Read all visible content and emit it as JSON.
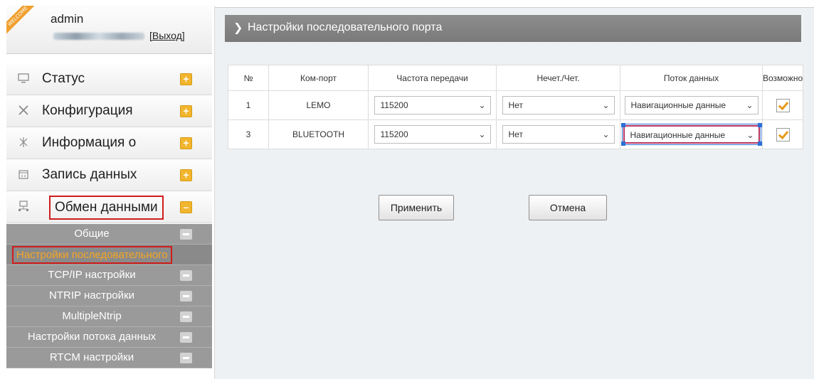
{
  "user": {
    "username": "admin",
    "logout_label": "[Выход]",
    "ribbon_text": "WELCOME"
  },
  "menu": [
    {
      "label": "Статус",
      "icon": "monitor-icon"
    },
    {
      "label": "Конфигурация",
      "icon": "tools-icon"
    },
    {
      "label": "Информация о",
      "icon": "satellite-icon"
    },
    {
      "label": "Запись данных",
      "icon": "calendar-icon"
    },
    {
      "label": "Обмен данными",
      "icon": "network-icon"
    }
  ],
  "submenu": [
    {
      "label": "Общие"
    },
    {
      "label": "Настройки последовательного"
    },
    {
      "label": "TCP/IP настройки"
    },
    {
      "label": "NTRIP настройки"
    },
    {
      "label": "MultipleNtrip"
    },
    {
      "label": "Настройки потока данных"
    },
    {
      "label": "RTCM настройки"
    }
  ],
  "content": {
    "title": "Настройки последовательного порта"
  },
  "table": {
    "headers": [
      "№",
      "Ком-порт",
      "Частота передачи",
      "Нечет./Чет.",
      "Поток данных",
      "Возможно"
    ],
    "rows": [
      {
        "num": "1",
        "port": "LEMO",
        "baud": "115200",
        "parity": "Нет",
        "stream": "Навигационные данные",
        "enabled": true
      },
      {
        "num": "3",
        "port": "BLUETOOTH",
        "baud": "115200",
        "parity": "Нет",
        "stream": "Навигационные данные",
        "enabled": true
      }
    ]
  },
  "buttons": {
    "apply": "Применить",
    "cancel": "Отмена"
  },
  "colors": {
    "accent_orange": "#f1b52e",
    "highlight_red": "#d11c1c",
    "selected_text": "#f5a623",
    "submenu_bg": "#9a9a9a",
    "header_bg": "#848484"
  }
}
